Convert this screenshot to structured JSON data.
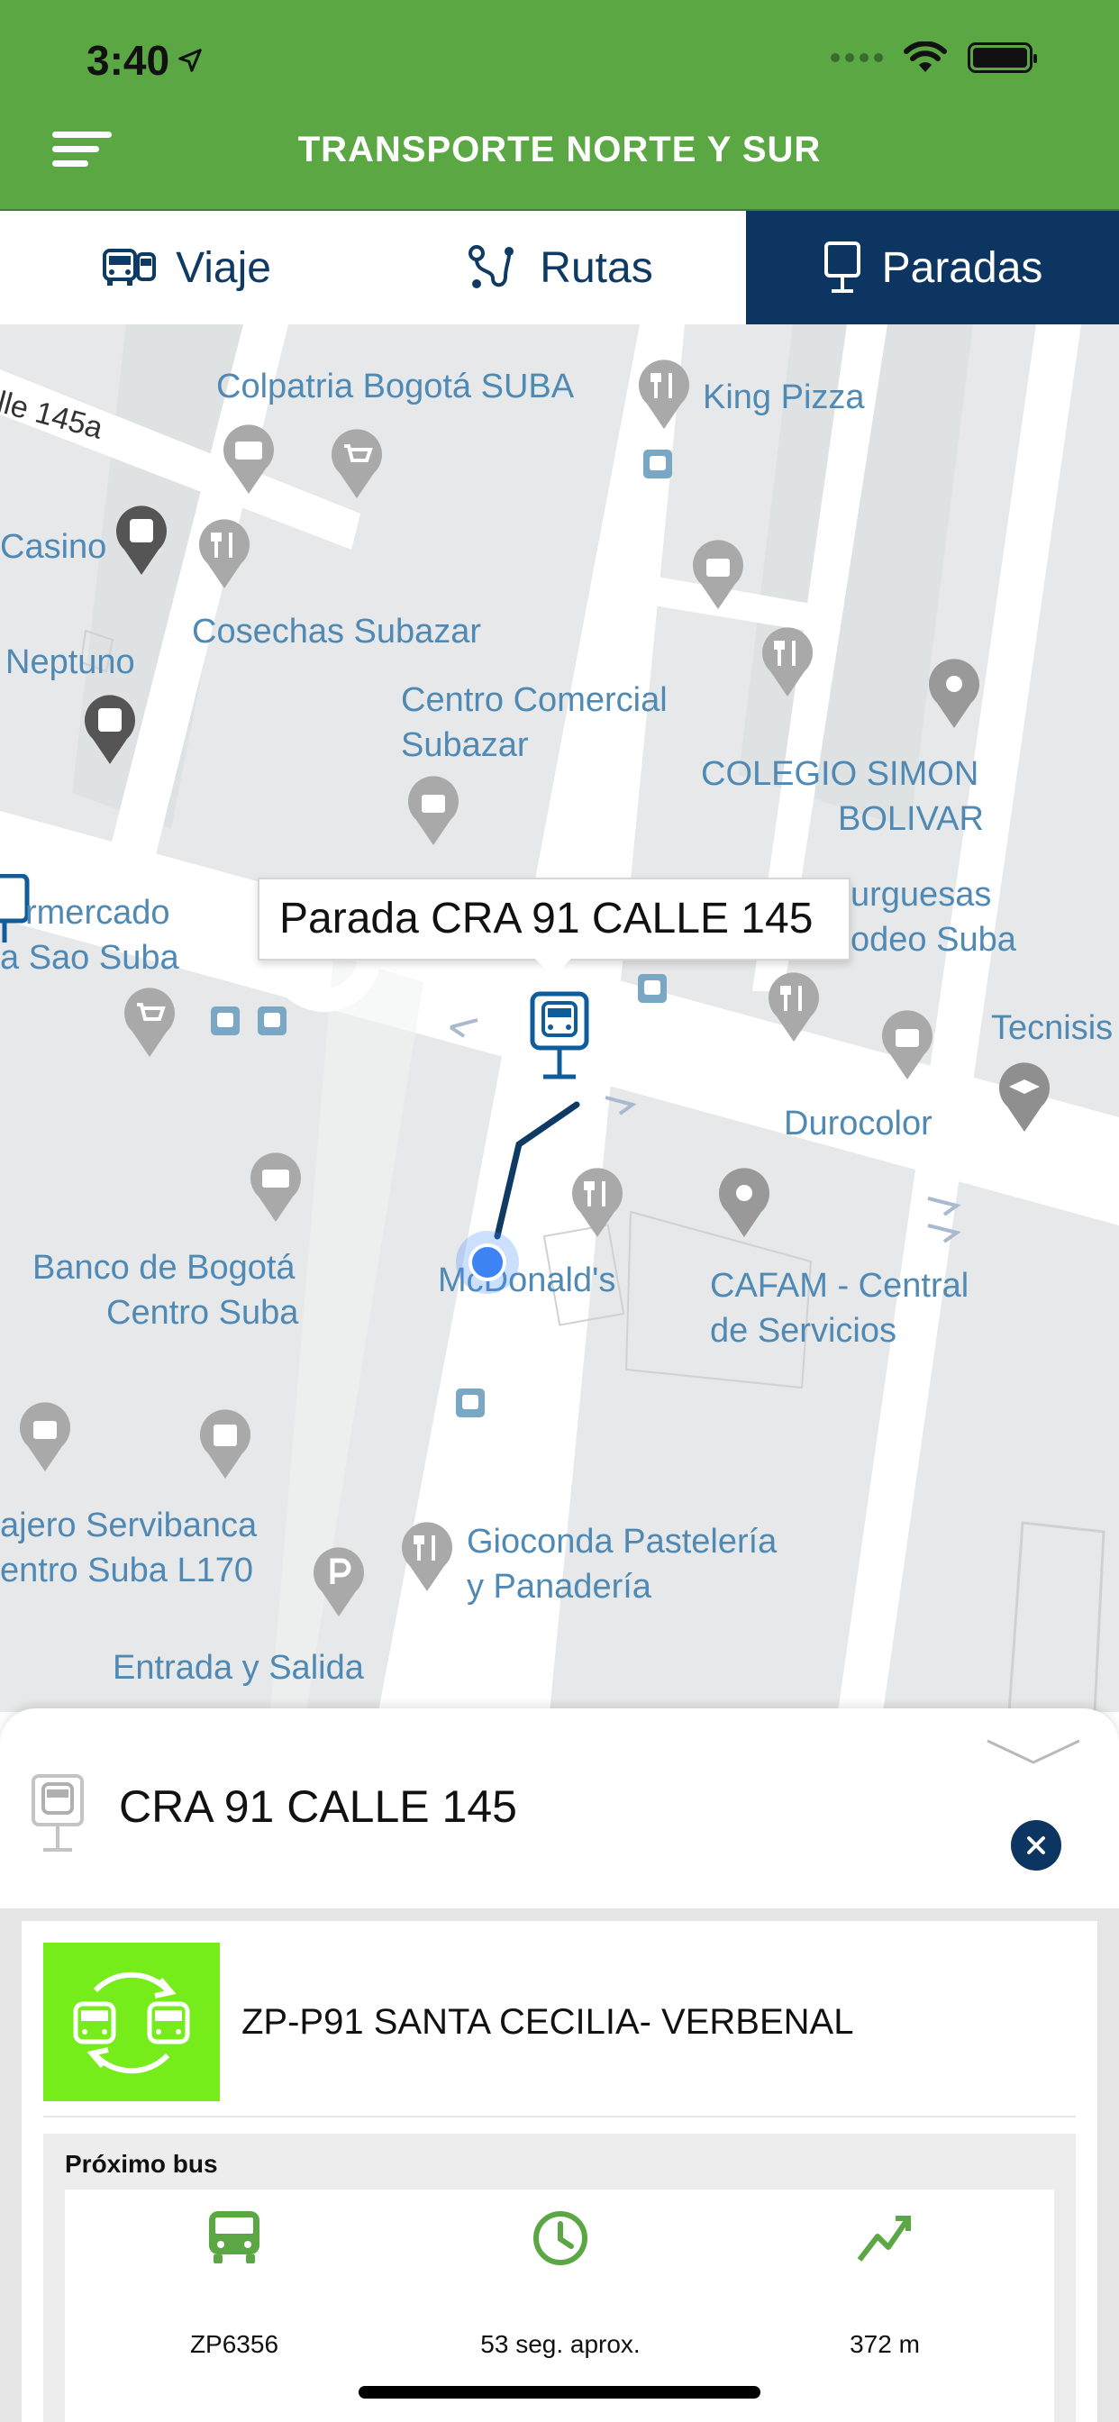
{
  "status": {
    "time": "3:40"
  },
  "header": {
    "title": "TRANSPORTE NORTE Y SUR"
  },
  "tabs": [
    {
      "label": "Viaje",
      "icon": "bus-icon",
      "active": false
    },
    {
      "label": "Rutas",
      "icon": "route-icon",
      "active": false
    },
    {
      "label": "Paradas",
      "icon": "stop-sign-icon",
      "active": true
    }
  ],
  "map": {
    "callout": "Parada CRA 91 CALLE 145",
    "labels": {
      "calle": "lle 145a",
      "colpatria": "Colpatria Bogotá SUBA",
      "king_pizza": "King Pizza",
      "casino": "Casino",
      "cosechas": "Cosechas Subazar",
      "neptuno": "Neptuno",
      "centro_comercial_1": "Centro Comercial",
      "centro_comercial_2": "Subazar",
      "colegio_1": "COLEGIO SIMON",
      "colegio_2": "BOLIVAR",
      "mercado_1": "rmercado",
      "mercado_2": "a Sao Suba",
      "burguesas_1": "urguesas",
      "burguesas_2": "odeo Suba",
      "tecnisis": "Tecnisis",
      "durocolor": "Durocolor",
      "banco_1": "Banco de Bogotá",
      "banco_2": "Centro Suba",
      "mcdonalds": "McDonald's",
      "cafam_1": "CAFAM - Central",
      "cafam_2": "de Servicios",
      "cajero_1": "ajero Servibanca",
      "cajero_2": "entro Suba L170",
      "gioconda_1": "Gioconda Pastelería",
      "gioconda_2": "y Panadería",
      "entrada": "Entrada y Salida"
    }
  },
  "sheet": {
    "stop_name": "CRA 91 CALLE 145",
    "route": {
      "name": "ZP-P91 SANTA CECILIA- VERBENAL",
      "badge_color": "#76ec1b"
    },
    "next_bus": {
      "title": "Próximo bus",
      "bus_id": "ZP6356",
      "eta": "53 seg. aprox.",
      "distance": "372 m"
    }
  },
  "colors": {
    "header": "#5aa744",
    "active_tab": "#0d3562",
    "map_label": "#4f89b4"
  }
}
